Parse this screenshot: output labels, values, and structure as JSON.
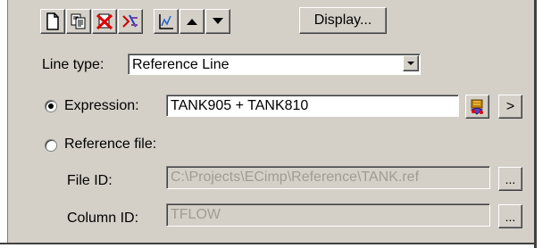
{
  "toolbar": {
    "buttons": [
      {
        "name": "new-document-icon"
      },
      {
        "name": "copy-icon"
      },
      {
        "name": "delete-icon"
      },
      {
        "name": "edit-expression-icon"
      },
      {
        "name": "graph-icon"
      },
      {
        "name": "move-up-icon"
      },
      {
        "name": "move-down-icon"
      }
    ],
    "display_label": "Display..."
  },
  "line_type": {
    "label": "Line type:",
    "value": "Reference Line"
  },
  "expression": {
    "label": "Expression:",
    "value": "TANK905 + TANK810",
    "selected": true,
    "more_label": ">"
  },
  "reference_file": {
    "label": "Reference file:",
    "selected": false,
    "file_id": {
      "label": "File ID:",
      "value": "C:\\Projects\\ECimp\\Reference\\TANK.ref",
      "browse_label": "..."
    },
    "column_id": {
      "label": "Column ID:",
      "value": "TFLOW",
      "browse_label": "..."
    }
  },
  "colors": {
    "face": "#d4d0c8",
    "disabled_text": "#a09c94"
  }
}
